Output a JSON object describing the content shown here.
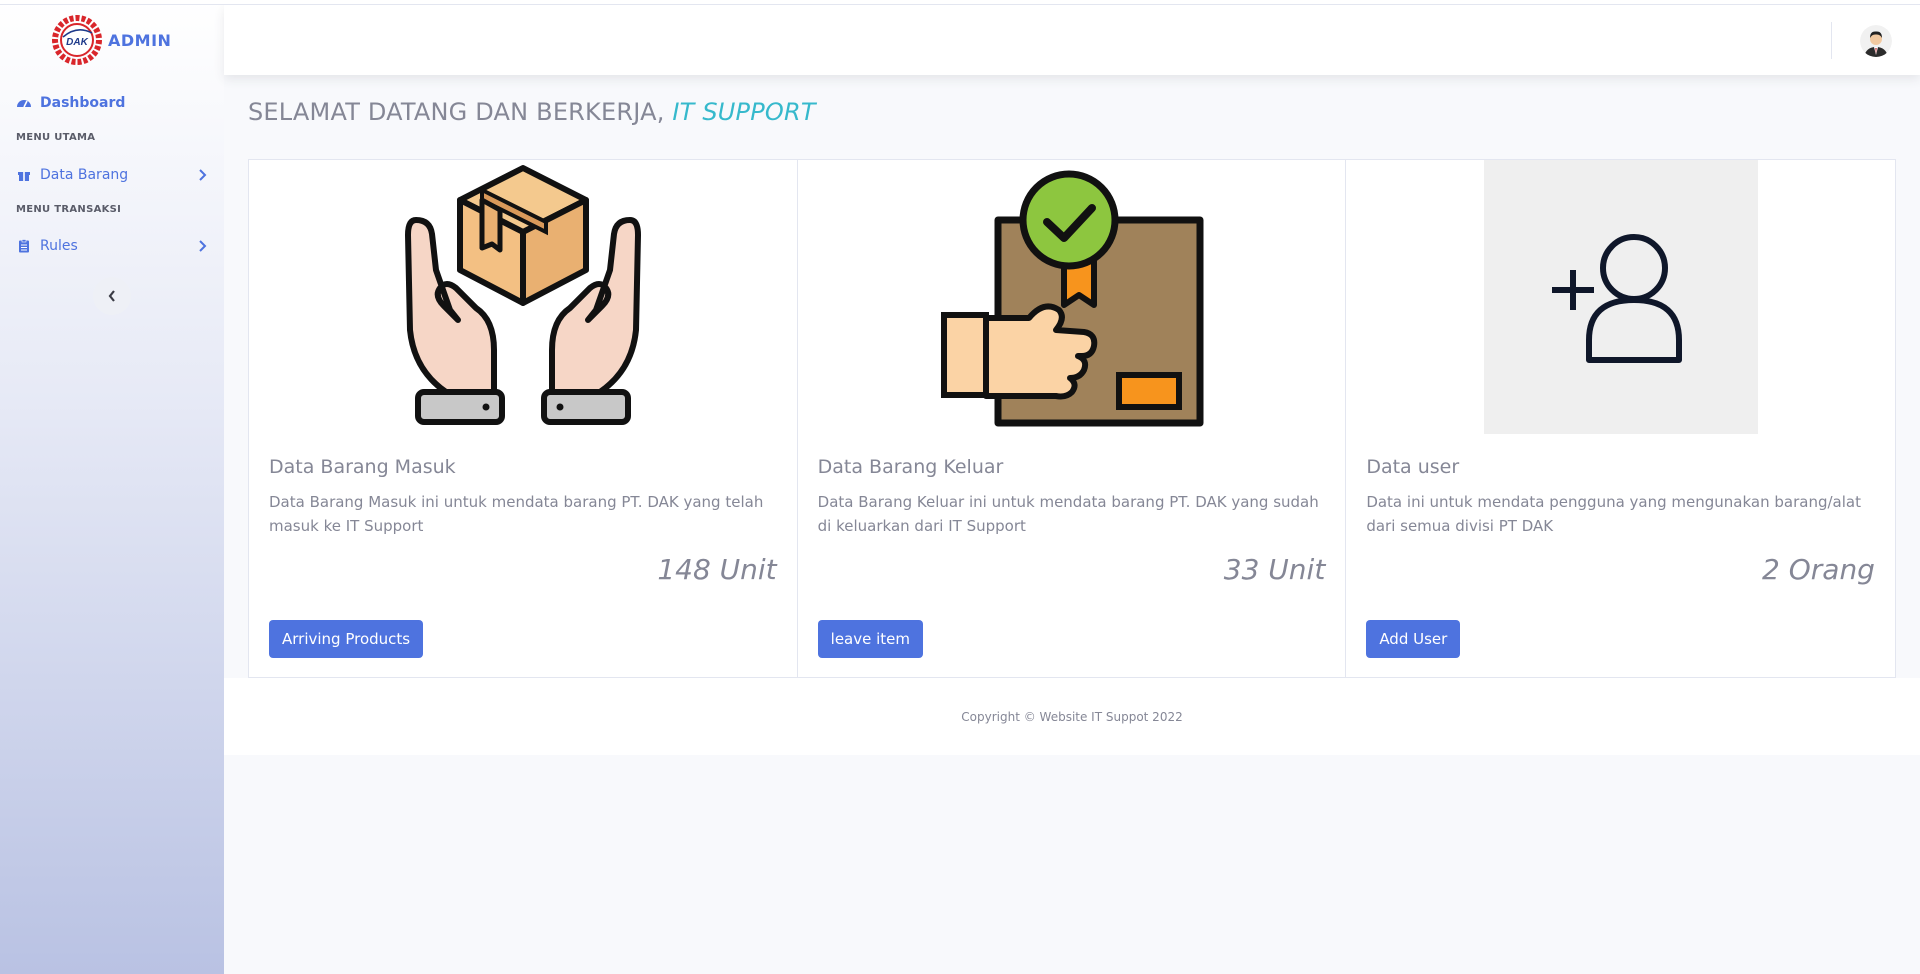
{
  "sidebar": {
    "brand": "ADMIN",
    "logo_text": "DAK",
    "dashboard_label": "Dashboard",
    "heading_main": "MENU UTAMA",
    "data_barang_label": "Data Barang",
    "heading_transaksi": "MENU TRANSAKSI",
    "rules_label": "Rules"
  },
  "page": {
    "title_prefix": "SELAMAT DATANG DAN BERKERJA, ",
    "title_highlight": "IT SUPPORT"
  },
  "cards": [
    {
      "title": "Data Barang Masuk",
      "text": "Data Barang Masuk ini untuk mendata barang PT. DAK yang telah masuk ke IT Support",
      "count": "148 Unit",
      "button": "Arriving Products",
      "icon": "hands-box-icon"
    },
    {
      "title": "Data Barang Keluar",
      "text": "Data Barang Keluar ini untuk mendata barang PT. DAK yang sudah di keluarkan dari IT Support",
      "count": "33 Unit",
      "button": "leave item",
      "icon": "package-delivered-icon"
    },
    {
      "title": "Data user",
      "text": "Data ini untuk mendata pengguna yang mengunakan barang/alat dari semua divisi PT DAK",
      "count": "2 Orang",
      "button": "Add User",
      "icon": "add-user-icon"
    }
  ],
  "footer": {
    "copyright": "Copyright © Website IT Suppot 2022"
  },
  "colors": {
    "primary": "#4e73df",
    "highlight": "#36b9cc",
    "text": "#858796"
  }
}
